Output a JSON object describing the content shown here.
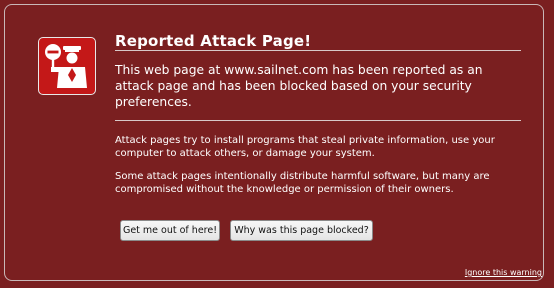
{
  "dialog": {
    "title": "Reported Attack Page!",
    "message": "This web page at www.sailnet.com has been reported as an attack page and has been blocked based on your security preferences.",
    "explanation": "Attack pages try to install programs that steal private information, use your computer to attack others, or damage your system.",
    "explanation2": "Some attack pages intentionally distribute harmful software, but many are compromised without the knowledge or permission of their owners.",
    "buttons": {
      "get_out": "Get me out of here!",
      "why_blocked": "Why was this page blocked?"
    },
    "ignore_link": "Ignore this warning",
    "icon": "police-officer-icon"
  },
  "colors": {
    "background": "#7a1f20",
    "icon_background": "#c41818",
    "text": "#ffffff"
  }
}
